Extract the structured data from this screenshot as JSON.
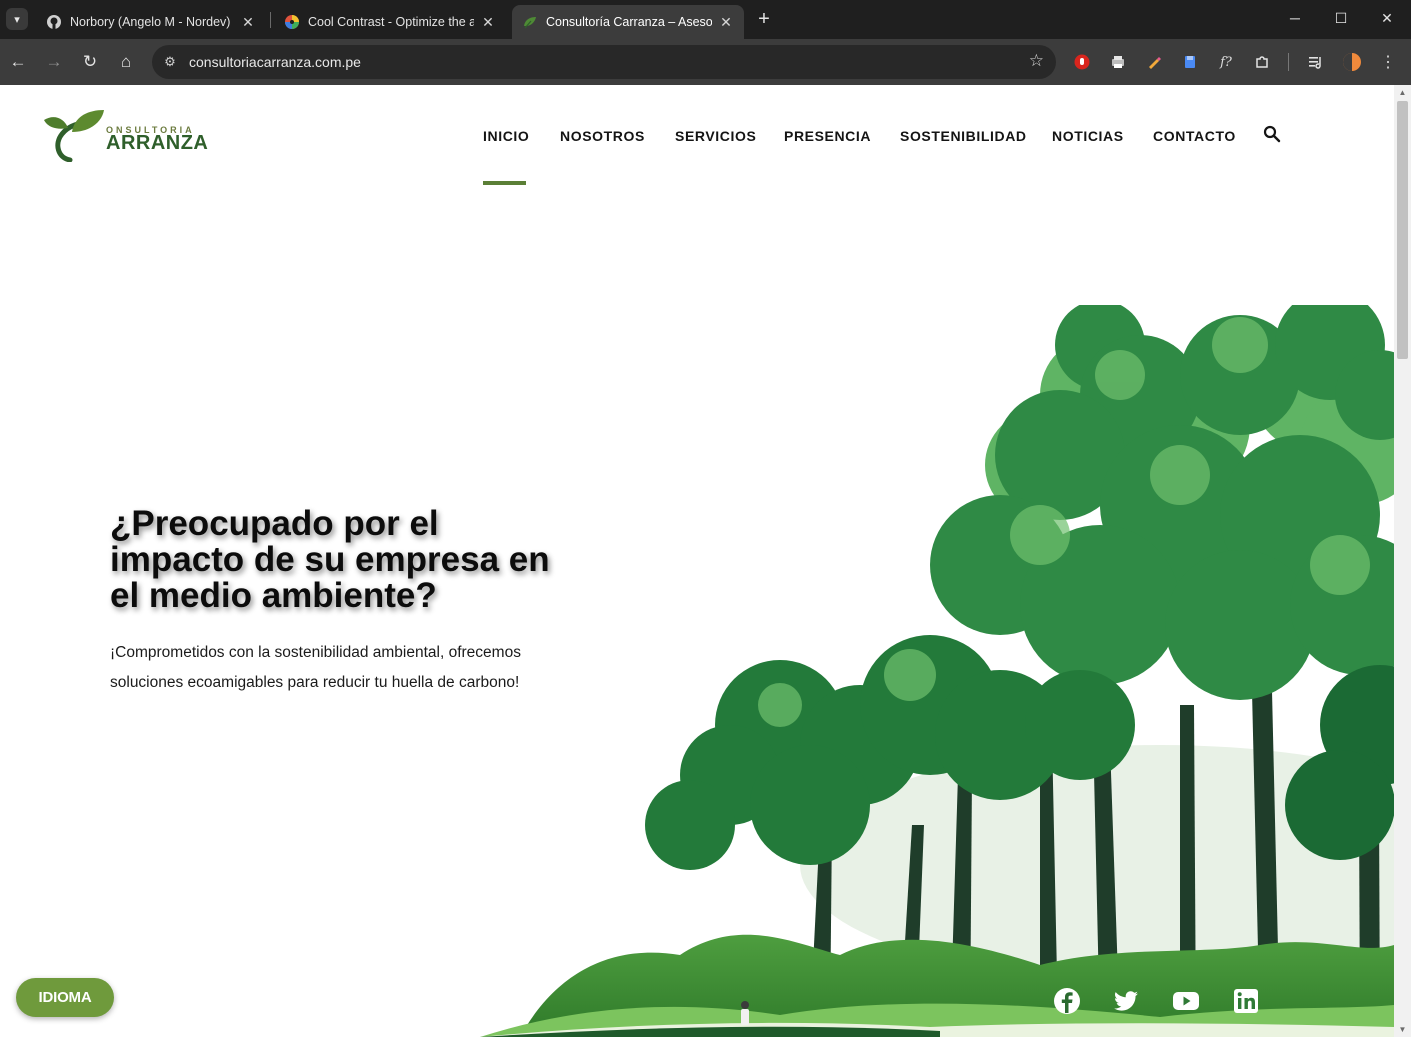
{
  "browser": {
    "tabs": [
      {
        "title": "Norbory (Angelo M - Nordev)",
        "favicon": "github-icon",
        "active": false
      },
      {
        "title": "Cool Contrast - Optimize the ac",
        "favicon": "color-wheel-icon",
        "active": false
      },
      {
        "title": "Consultoría Carranza – Asesoram",
        "favicon": "leaf-icon",
        "active": true
      }
    ],
    "new_tab_label": "+",
    "url": "consultoriacarranza.com.pe"
  },
  "site": {
    "logo": {
      "top_text": "ONSULTORIA",
      "main_text": "ARRANZA"
    },
    "nav": [
      {
        "label": "INICIO",
        "active": true
      },
      {
        "label": "NOSOTROS",
        "active": false
      },
      {
        "label": "SERVICIOS",
        "active": false
      },
      {
        "label": "PRESENCIA",
        "active": false
      },
      {
        "label": "SOSTENIBILIDAD",
        "active": false
      },
      {
        "label": "NOTICIAS",
        "active": false
      },
      {
        "label": "CONTACTO",
        "active": false
      }
    ],
    "hero": {
      "title": "¿Preocupado por el impacto de su empresa en el medio ambiente?",
      "subtitle": "¡Comprometidos con la sostenibilidad ambiental, ofrecemos soluciones ecoamigables para reducir tu huella de carbono!"
    },
    "language_button": "IDIOMA",
    "social": [
      "facebook-icon",
      "twitter-icon",
      "youtube-icon",
      "linkedin-icon"
    ],
    "colors": {
      "accent": "#5b7f36",
      "button": "#6f9a3c",
      "tree_dark": "#1d6a34",
      "tree_light": "#4fae5a"
    }
  }
}
